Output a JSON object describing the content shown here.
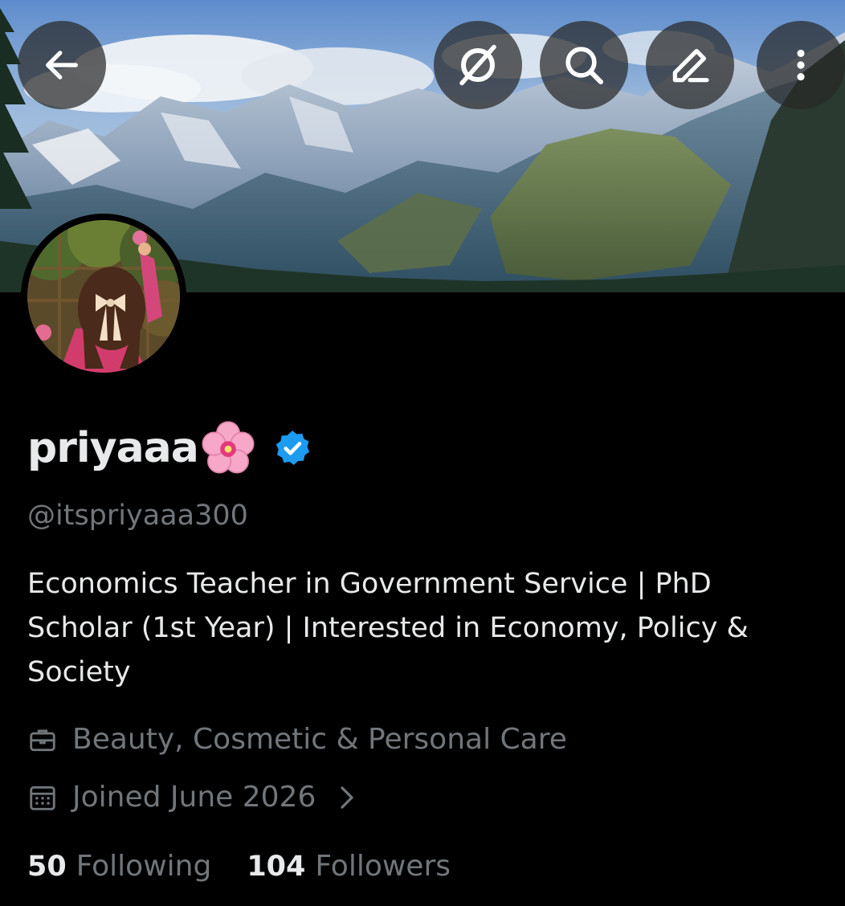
{
  "header": {
    "back_icon": "arrow-left-icon",
    "grok_icon": "grok-icon",
    "search_icon": "search-icon",
    "edit_icon": "pencil-icon",
    "more_icon": "more-vertical-icon"
  },
  "profile": {
    "display_name": "priyaaa",
    "name_emoji": "cherry-blossom",
    "verified": true,
    "handle": "@itspriyaaa300",
    "bio": "Economics Teacher in Government Service | PhD Scholar (1st Year) | Interested in Economy, Policy & Society",
    "category": "Beauty, Cosmetic & Personal Care",
    "joined": "Joined June 2026"
  },
  "stats": {
    "following_count": "50",
    "following_label": "Following",
    "followers_count": "104",
    "followers_label": "Followers"
  },
  "colors": {
    "background": "#000000",
    "text_primary": "#e7e9ea",
    "text_secondary": "#71767b",
    "verified_blue": "#1d9bf0",
    "button_bg": "rgba(40,40,40,0.72)"
  }
}
